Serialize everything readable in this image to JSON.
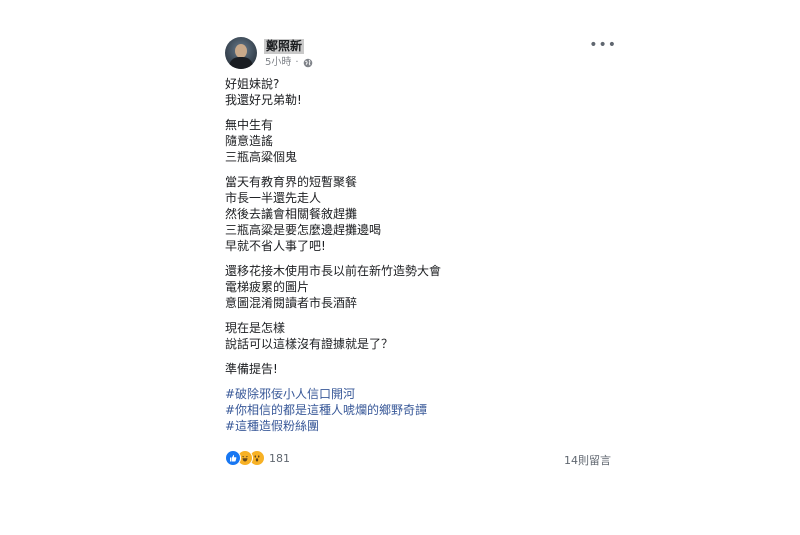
{
  "post": {
    "author": "鄭照新",
    "timestamp": "5小時",
    "separator": "·",
    "privacy_icon": "globe-icon",
    "more_label": "•••",
    "paragraphs": [
      [
        "好姐妹說?",
        "我還好兄弟勒!"
      ],
      [
        "無中生有",
        "隨意造謠",
        "三瓶高粱個鬼"
      ],
      [
        "當天有教育界的短暫聚餐",
        "市長一半還先走人",
        "然後去議會相關餐敘趕攤",
        "三瓶高粱是要怎麼邊趕攤邊喝",
        "早就不省人事了吧!"
      ],
      [
        "還移花接木使用市長以前在新竹造勢大會",
        "電梯疲累的圖片",
        "意圖混淆閱讀者市長酒醉"
      ],
      [
        "現在是怎樣",
        "說話可以這樣沒有證據就是了？"
      ],
      [
        "準備提告!"
      ]
    ],
    "hashtags": [
      "#破除邪佞小人信口開河",
      "#你相信的都是這種人唬爛的鄉野奇譚",
      "#這種造假粉絲團"
    ]
  },
  "footer": {
    "reactions": [
      "like-icon",
      "haha-icon",
      "wow-icon"
    ],
    "reaction_count": "181",
    "comments": "14則留言"
  },
  "colors": {
    "hashtag": "#385898",
    "like": "#1877f2",
    "emoji": "#f7b125",
    "meta": "#7f8389"
  }
}
